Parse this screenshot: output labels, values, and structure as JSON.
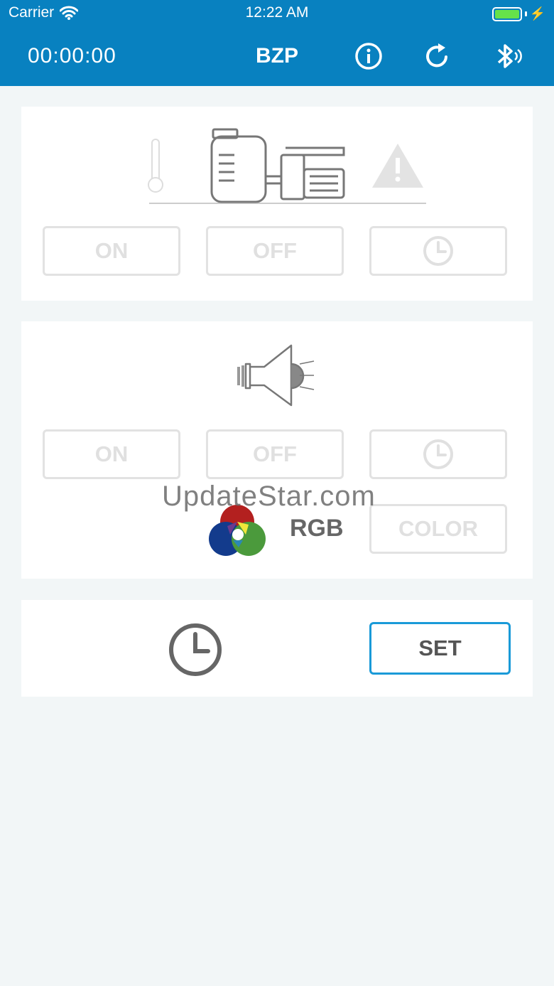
{
  "status_bar": {
    "carrier": "Carrier",
    "time": "12:22 AM"
  },
  "nav": {
    "timer": "00:00:00",
    "title": "BZP",
    "icons": [
      "info-icon",
      "refresh-icon",
      "bluetooth-icon"
    ]
  },
  "pump_card": {
    "icons": [
      "thermometer-icon",
      "pump-icon",
      "warning-icon"
    ],
    "on_label": "ON",
    "off_label": "OFF",
    "timer_icon": "clock-icon"
  },
  "sound_card": {
    "icon": "speaker-icon",
    "on_label": "ON",
    "off_label": "OFF",
    "timer_icon": "clock-icon",
    "rgb_label": "RGB",
    "color_label": "COLOR"
  },
  "clock_card": {
    "icon": "clock-icon",
    "set_label": "SET"
  },
  "watermark": "UpdateStar.com",
  "colors": {
    "nav_bg": "#0881c0",
    "page_bg": "#f2f6f7",
    "set_border": "#1a9ad8",
    "battery": "#66e24a"
  }
}
